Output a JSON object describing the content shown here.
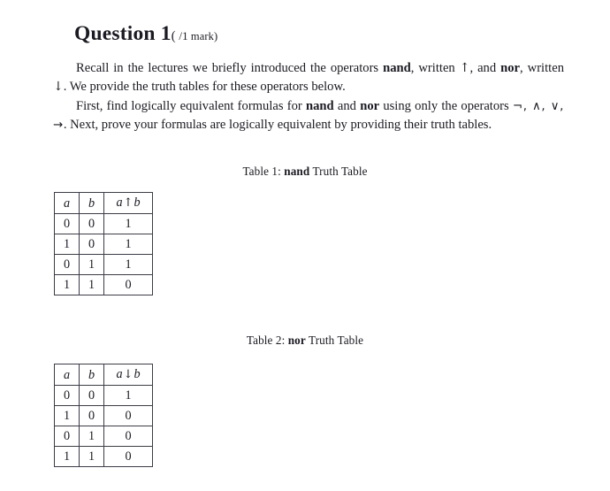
{
  "document": {
    "heading": {
      "title": "Question 1",
      "marks_open": "( ",
      "marks_value": "/1",
      "marks_word": " mark)"
    },
    "paragraphs": [
      {
        "id": "intro",
        "segments": [
          {
            "type": "text",
            "text": "Recall in the lectures we briefly introduced the operators "
          },
          {
            "type": "bold",
            "text": "nand"
          },
          {
            "type": "text",
            "text": ", written "
          },
          {
            "type": "symbol",
            "text": "↑"
          },
          {
            "type": "text",
            "text": ", and "
          },
          {
            "type": "bold",
            "text": "nor"
          },
          {
            "type": "text",
            "text": ", written "
          },
          {
            "type": "symbol",
            "text": "↓"
          },
          {
            "type": "text",
            "text": ". We provide the truth tables for these operators below."
          }
        ],
        "plain": "Recall in the lectures we briefly introduced the operators nand, written ↑, and nor, written ↓. We provide the truth tables for these operators below."
      },
      {
        "id": "task",
        "segments": [
          {
            "type": "text",
            "text": "First, find logically equivalent formulas for "
          },
          {
            "type": "bold",
            "text": "nand"
          },
          {
            "type": "text",
            "text": " and "
          },
          {
            "type": "bold",
            "text": "nor"
          },
          {
            "type": "text",
            "text": " using only the operators "
          },
          {
            "type": "opset",
            "text": "¬, ∧, ∨, →"
          },
          {
            "type": "text",
            "text": ".  Next, prove your formulas are logically equivalent by providing their truth tables."
          }
        ],
        "plain": "First, find logically equivalent formulas for nand and nor using only the operators ¬, ∧, ∨, →.  Next, prove your formulas are logically equivalent by providing their truth tables."
      }
    ],
    "tables": [
      {
        "caption": {
          "prefix": "Table 1: ",
          "operator": "nand",
          "suffix": " Truth Table"
        },
        "headers": [
          "a",
          "b",
          "a ↑ b"
        ],
        "header_parts": {
          "left": "a",
          "arrow": "↑",
          "right": "b"
        },
        "rows": [
          [
            "0",
            "0",
            "1"
          ],
          [
            "1",
            "0",
            "1"
          ],
          [
            "0",
            "1",
            "1"
          ],
          [
            "1",
            "1",
            "0"
          ]
        ]
      },
      {
        "caption": {
          "prefix": "Table 2: ",
          "operator": "nor",
          "suffix": " Truth Table"
        },
        "headers": [
          "a",
          "b",
          "a ↓ b"
        ],
        "header_parts": {
          "left": "a",
          "arrow": "↓",
          "right": "b"
        },
        "rows": [
          [
            "0",
            "0",
            "1"
          ],
          [
            "1",
            "0",
            "0"
          ],
          [
            "0",
            "1",
            "0"
          ],
          [
            "1",
            "1",
            "0"
          ]
        ]
      }
    ],
    "colors": {
      "page_background": "#ffffff",
      "text": "#1a1a22",
      "table_border": "#3c3c46"
    }
  }
}
